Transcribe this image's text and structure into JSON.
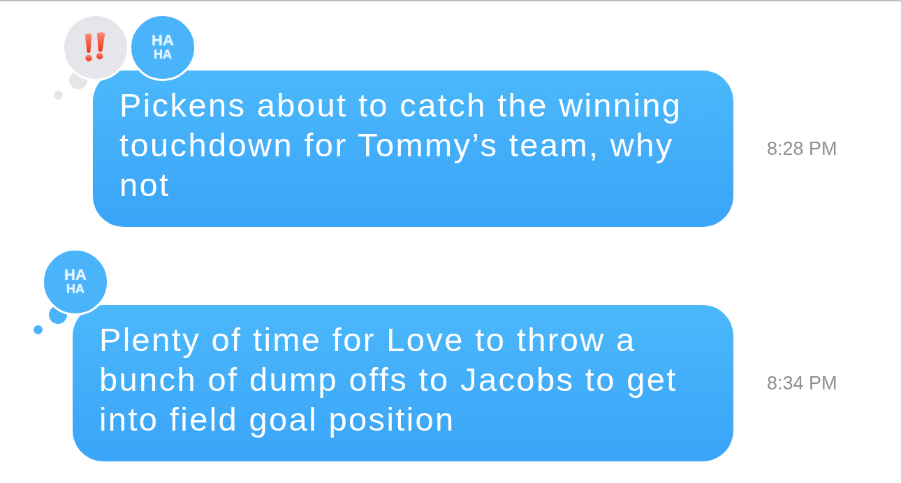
{
  "messages": [
    {
      "text": "Pickens about to catch the winning touchdown for Tommy’s team, why not",
      "time": "8:28 PM",
      "reactions": [
        {
          "kind": "emphasis",
          "mine": false
        },
        {
          "kind": "haha",
          "mine": true,
          "label": [
            "HA",
            "HA"
          ]
        }
      ]
    },
    {
      "text": "Plenty of time for Love to throw a bunch of dump offs to Jacobs to get into field goal position",
      "time": "8:34 PM",
      "reactions": [
        {
          "kind": "haha",
          "mine": true,
          "label": [
            "HA",
            "HA"
          ]
        }
      ]
    }
  ]
}
